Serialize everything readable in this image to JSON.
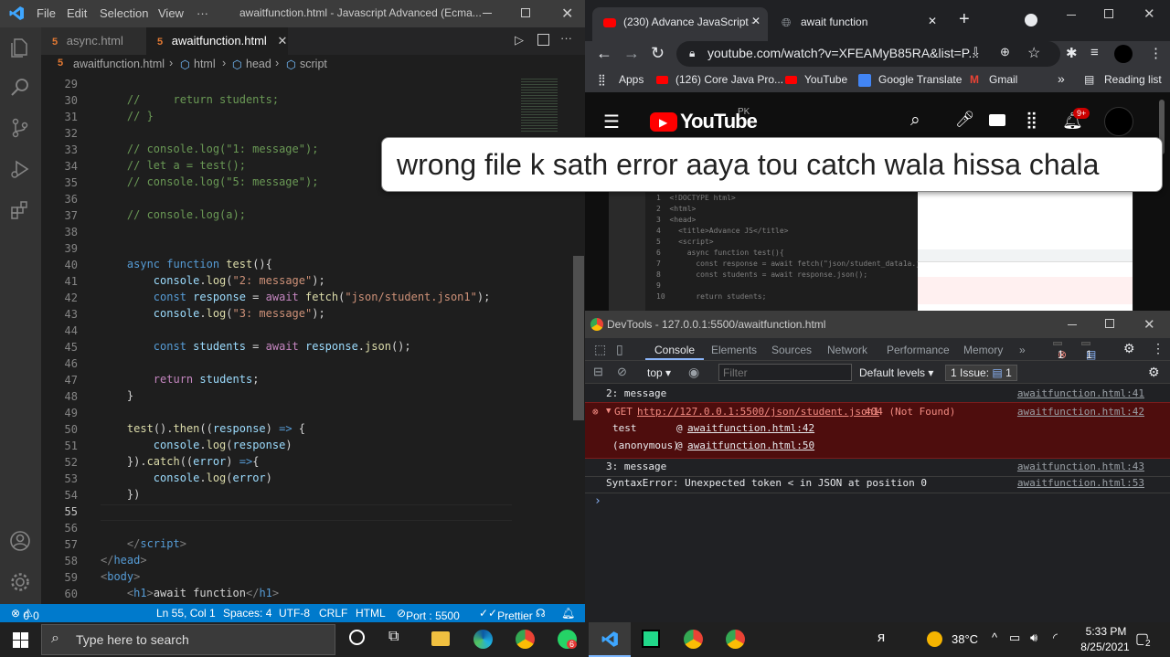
{
  "vscode": {
    "menu": [
      "File",
      "Edit",
      "Selection",
      "View",
      "···"
    ],
    "window_title": "awaitfunction.html - Javascript Advanced (Ecma...",
    "tabs": [
      {
        "label": "async.html",
        "active": false
      },
      {
        "label": "awaitfunction.html",
        "active": true
      }
    ],
    "breadcrumb": [
      "awaitfunction.html",
      "html",
      "head",
      "script"
    ],
    "line_numbers": [
      "29",
      "30",
      "31",
      "32",
      "33",
      "34",
      "35",
      "36",
      "37",
      "38",
      "39",
      "40",
      "41",
      "42",
      "43",
      "44",
      "45",
      "46",
      "47",
      "48",
      "49",
      "50",
      "51",
      "52",
      "53",
      "54",
      "55",
      "56",
      "57",
      "58",
      "59",
      "60"
    ],
    "status": {
      "errors": "0",
      "warnings": "0",
      "position": "Ln 55, Col 1",
      "spaces": "Spaces: 4",
      "encoding": "UTF-8",
      "eol": "CRLF",
      "language": "HTML",
      "port": "Port : 5500",
      "prettier": "Prettier"
    }
  },
  "chrome": {
    "tabs": [
      {
        "label": "(230) Advance JavaScript -",
        "active": true
      },
      {
        "label": "await function",
        "active": false
      }
    ],
    "url": "youtube.com/watch?v=XFEAMyB85RA&list=P...",
    "bookmarks": [
      "Apps",
      "(126) Core Java Pro...",
      "YouTube",
      "Google Translate",
      "Gmail",
      "Reading list"
    ],
    "yt_logo": "YouTube",
    "yt_region": "PK",
    "notif_count": "9+"
  },
  "overlay_text": "wrong file k sath error aaya tou catch wala hissa chala",
  "devtools": {
    "title": "DevTools - 127.0.0.1:5500/awaitfunction.html",
    "tabs": [
      "Console",
      "Elements",
      "Sources",
      "Network",
      "Performance",
      "Memory",
      "»"
    ],
    "error_badge": "1",
    "issue_badge": "1",
    "context": "top",
    "filter_placeholder": "Filter",
    "levels": "Default levels",
    "issues": "1 Issue:",
    "issues_count": "1",
    "messages": [
      {
        "text": "2: message",
        "src": "awaitfunction.html:41"
      },
      {
        "text": "GET",
        "url": "http://127.0.0.1:5500/json/student.json1",
        "status": "404 (Not Found)",
        "src": "awaitfunction.html:42"
      },
      {
        "text": "test",
        "at": "@",
        "link": "awaitfunction.html:42"
      },
      {
        "text": "(anonymous)",
        "at": "@",
        "link": "awaitfunction.html:50"
      },
      {
        "text": "3: message",
        "src": "awaitfunction.html:43"
      },
      {
        "text": "SyntaxError: Unexpected token < in JSON at position 0",
        "src": "awaitfunction.html:53"
      }
    ],
    "prompt": "›"
  },
  "taskbar": {
    "search_placeholder": "Type here to search",
    "temperature": "38°C",
    "time": "5:33 PM",
    "date": "8/25/2021",
    "notif": "2",
    "whatsapp_badge": "6"
  },
  "colors": {
    "vscode_blue": "#007acc",
    "error_bg": "#4e0d0d",
    "youtube_red": "#ff0000"
  }
}
